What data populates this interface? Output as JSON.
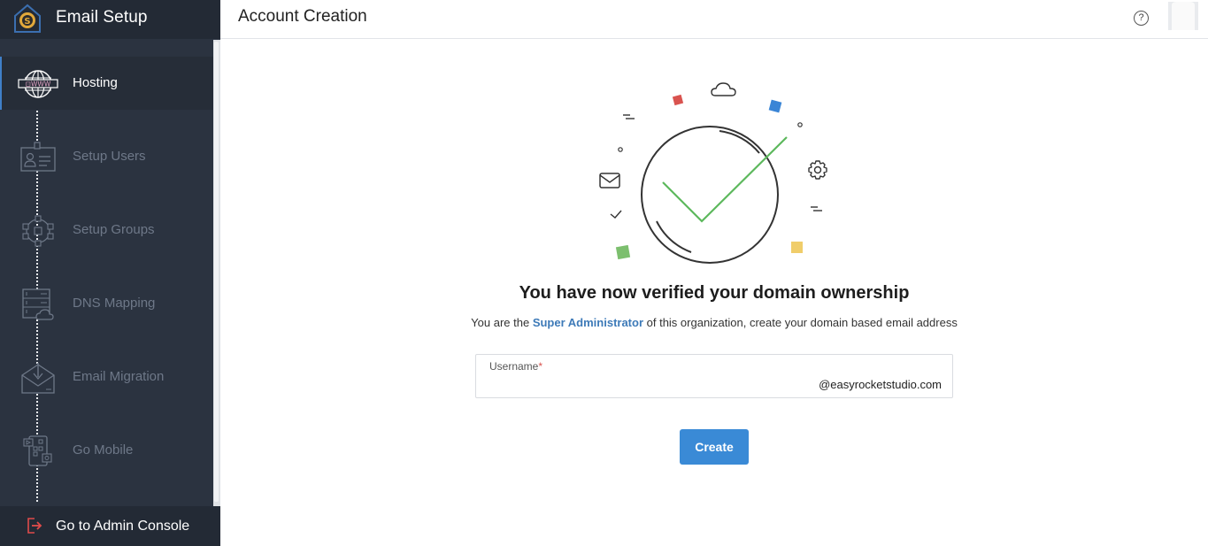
{
  "sidebar": {
    "title": "Email Setup",
    "brand_icon": "email-setup-gear-house-icon",
    "items": [
      {
        "label": "Hosting",
        "icon": "globe-www-icon",
        "active": true
      },
      {
        "label": "Setup Users",
        "icon": "id-card-icon",
        "active": false
      },
      {
        "label": "Setup Groups",
        "icon": "group-network-icon",
        "active": false
      },
      {
        "label": "DNS Mapping",
        "icon": "server-cloud-icon",
        "active": false
      },
      {
        "label": "Email Migration",
        "icon": "envelope-download-icon",
        "active": false
      },
      {
        "label": "Go Mobile",
        "icon": "mobile-apps-icon",
        "active": false
      }
    ],
    "footer": {
      "label": "Go to Admin Console",
      "icon": "exit-icon"
    }
  },
  "header": {
    "title": "Account Creation",
    "help_icon": "?",
    "avatar": "user-avatar"
  },
  "main": {
    "headline": "You have now verified your domain ownership",
    "subtext_prefix": "You are the ",
    "subtext_role": "Super Administrator",
    "subtext_suffix": " of this organization, create your domain based email address",
    "username_field": {
      "label": "Username",
      "required_mark": "*",
      "value": "",
      "placeholder": "",
      "suffix": "@easyrocketstudio.com"
    },
    "create_button": "Create"
  },
  "colors": {
    "sidebar_bg": "#2b3340",
    "accent_blue": "#3a8ad6",
    "link_blue": "#3d7ab8",
    "check_green": "#5cb85c",
    "confetti": [
      "#d9534f",
      "#3a85d6",
      "#7cbf6e",
      "#f0cd6a"
    ]
  }
}
